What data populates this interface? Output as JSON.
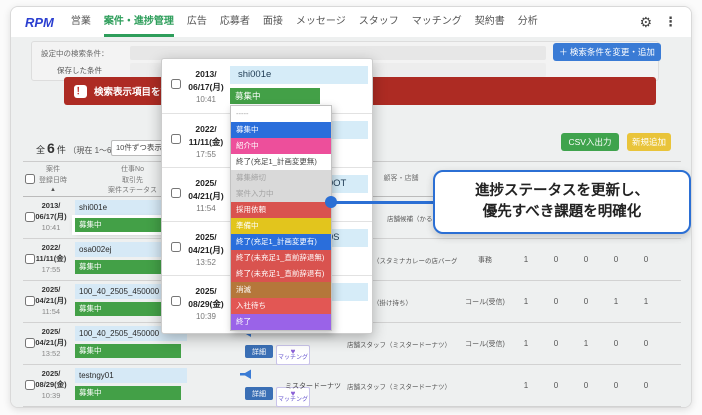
{
  "nav": {
    "logo": "RPM",
    "items": [
      {
        "label": "営業",
        "active": false
      },
      {
        "label": "案件・進捗管理",
        "active": true
      },
      {
        "label": "広告",
        "active": false
      },
      {
        "label": "応募者",
        "active": false
      },
      {
        "label": "面接",
        "active": false
      },
      {
        "label": "メッセージ",
        "active": false
      },
      {
        "label": "スタッフ",
        "active": false
      },
      {
        "label": "マッチング",
        "active": false
      },
      {
        "label": "契約書",
        "active": false
      },
      {
        "label": "分析",
        "active": false
      }
    ]
  },
  "search_panel": {
    "current_label": "設定中の検索条件：",
    "saved_label": "保存した条件",
    "change_button": "＋ 検索条件を変更・追加"
  },
  "alert": {
    "icon": "！",
    "text": "検索表示項目を管理者が変更"
  },
  "toolbar": {
    "total_prefix": "全",
    "total_count": "6",
    "total_suffix": "件",
    "range": "（現在 1〜6件）",
    "page_size": "10件ずつ表示",
    "caret": "▼",
    "csv_button": "CSV入出力",
    "new_button": "新規追加"
  },
  "table": {
    "headers": {
      "col_date_l1": "案件",
      "col_date_l2": "登録日時",
      "sort": "▲",
      "col_job_l1": "仕事No",
      "col_job_l2": "取引先",
      "col_job_l3": "案件ステータス",
      "col_client": "顧客・店舗"
    },
    "rows": [
      {
        "date1": "2013/",
        "date2": "06/17(月)",
        "time": "10:41",
        "job_no": "shi001e",
        "status": "募集中",
        "highlight": true,
        "client": "",
        "role": "店舗候補（かるび家）",
        "role_pad": true,
        "category": "",
        "counts": [
          "",
          "",
          "",
          "",
          ""
        ]
      },
      {
        "date1": "2022/",
        "date2": "11/11(金)",
        "time": "17:55",
        "job_no": "osa002ej",
        "status": "募集中",
        "highlight": false,
        "client": "",
        "role": "スタッフ（スタミナカレーの店バーグ）",
        "role_pad": false,
        "category": "事務",
        "counts": [
          "1",
          "0",
          "0",
          "0",
          "0"
        ]
      },
      {
        "date1": "2025/",
        "date2": "04/21(月)",
        "time": "11:54",
        "job_no": "100_40_2505_450000",
        "status": "募集中",
        "highlight": false,
        "client": "",
        "role": "店舗候補（掛け持ち）",
        "role_pad": false,
        "category": "コール(受信)",
        "counts": [
          "1",
          "0",
          "0",
          "1",
          "1"
        ]
      },
      {
        "date1": "2025/",
        "date2": "04/21(月)",
        "time": "13:52",
        "job_no": "100_40_2505_450000",
        "status": "募集中",
        "highlight": false,
        "client": "",
        "role": "店舗スタッフ（ミスタードーナツ）",
        "role_pad": false,
        "category": "コール(受信)",
        "counts": [
          "1",
          "0",
          "1",
          "0",
          "0"
        ]
      },
      {
        "date1": "2025/",
        "date2": "08/29(金)",
        "time": "10:39",
        "job_no": "testngy01",
        "status": "募集中",
        "highlight": false,
        "client": "ミスタードーナツ",
        "role": "店舗スタッフ（ミスタードーナツ）",
        "role_pad": false,
        "category": "",
        "counts": [
          "1",
          "0",
          "0",
          "0",
          "0"
        ]
      }
    ]
  },
  "row_actions": {
    "detail": "詳細",
    "matching": "マッチング"
  },
  "popup": {
    "rows": [
      {
        "date1": "2013/",
        "date2": "06/17(月)",
        "time": "10:41",
        "job_no": "shi001e",
        "status": "募集中",
        "open": true
      },
      {
        "date1": "2022/",
        "date2": "11/11(金)",
        "time": "17:55",
        "job_no": "osa002ej",
        "status": "募集中",
        "open": false
      },
      {
        "date1": "2025/",
        "date2": "04/21(月)",
        "time": "11:54",
        "job_no": "100_40_2505_450000OT",
        "status": "募集中",
        "open": false
      },
      {
        "date1": "2025/",
        "date2": "04/21(月)",
        "time": "13:52",
        "job_no": "100_40_2505_450000S",
        "status": "募集中",
        "open": false
      },
      {
        "date1": "2025/",
        "date2": "08/29(金)",
        "time": "10:39",
        "job_no": "testngy01",
        "status": "募集中",
        "open": false
      }
    ],
    "dropdown": {
      "options": [
        {
          "label": "-----",
          "bg": "#ffffff",
          "fg": "#999999"
        },
        {
          "label": "募集中",
          "bg": "#2a6edb",
          "fg": "#ffffff"
        },
        {
          "label": "紹介中",
          "bg": "#ed4f9b",
          "fg": "#ffffff"
        },
        {
          "label": "終了(充足1_計画変更無)",
          "bg": "#ffffff",
          "fg": "#444444"
        },
        {
          "label": "募集締切",
          "bg": "#d9d9d9",
          "fg": "#a3a3a3"
        },
        {
          "label": "案件入力中",
          "bg": "#d9d9d9",
          "fg": "#a3a3a3"
        },
        {
          "label": "採用依頼",
          "bg": "#d9534f",
          "fg": "#ffffff"
        },
        {
          "label": "準備中",
          "bg": "#e2c51d",
          "fg": "#ffffff"
        },
        {
          "label": "終了(充足1_計画変更有)",
          "bg": "#2a6edb",
          "fg": "#ffffff"
        },
        {
          "label": "終了(未充足1_直前辞退無)",
          "bg": "#d9534f",
          "fg": "#ffffff"
        },
        {
          "label": "終了(未充足1_直前辞退有)",
          "bg": "#d9534f",
          "fg": "#ffffff"
        },
        {
          "label": "消滅",
          "bg": "#b5773a",
          "fg": "#ffffff"
        },
        {
          "label": "入社待ち",
          "bg": "#e25754",
          "fg": "#ffffff"
        },
        {
          "label": "終了",
          "bg": "#9a63e8",
          "fg": "#ffffff"
        }
      ]
    }
  },
  "callout": {
    "line1": "進捗ステータスを更新し、",
    "line2": "優先すべき課題を明確化"
  },
  "colors": {
    "status_open": "#43a047",
    "accent_blue": "#2b6fd4",
    "alert_red": "#ad2b23",
    "nav_active_green": "#2e9e5b"
  }
}
